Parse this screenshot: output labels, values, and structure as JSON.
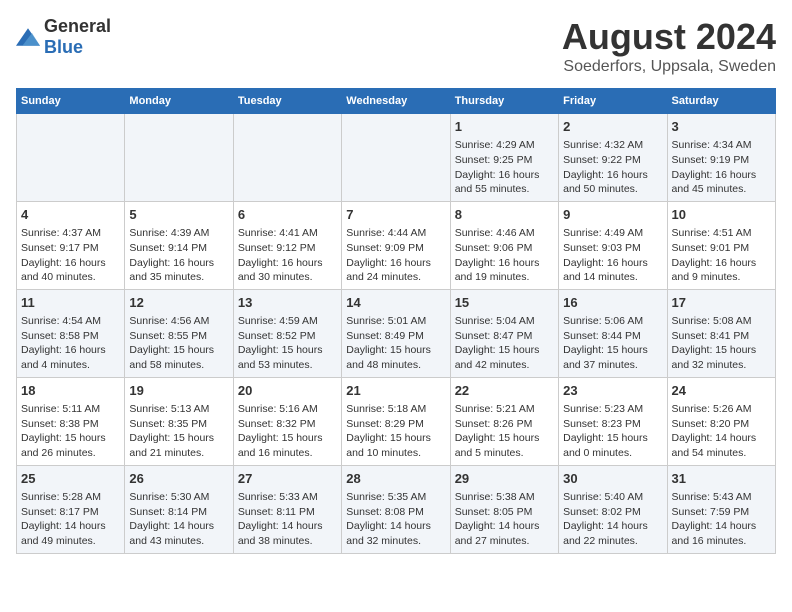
{
  "header": {
    "logo_general": "General",
    "logo_blue": "Blue",
    "title": "August 2024",
    "subtitle": "Soederfors, Uppsala, Sweden"
  },
  "columns": [
    "Sunday",
    "Monday",
    "Tuesday",
    "Wednesday",
    "Thursday",
    "Friday",
    "Saturday"
  ],
  "weeks": [
    [
      {
        "day": "",
        "lines": []
      },
      {
        "day": "",
        "lines": []
      },
      {
        "day": "",
        "lines": []
      },
      {
        "day": "",
        "lines": []
      },
      {
        "day": "1",
        "lines": [
          "Sunrise: 4:29 AM",
          "Sunset: 9:25 PM",
          "Daylight: 16 hours",
          "and 55 minutes."
        ]
      },
      {
        "day": "2",
        "lines": [
          "Sunrise: 4:32 AM",
          "Sunset: 9:22 PM",
          "Daylight: 16 hours",
          "and 50 minutes."
        ]
      },
      {
        "day": "3",
        "lines": [
          "Sunrise: 4:34 AM",
          "Sunset: 9:19 PM",
          "Daylight: 16 hours",
          "and 45 minutes."
        ]
      }
    ],
    [
      {
        "day": "4",
        "lines": [
          "Sunrise: 4:37 AM",
          "Sunset: 9:17 PM",
          "Daylight: 16 hours",
          "and 40 minutes."
        ]
      },
      {
        "day": "5",
        "lines": [
          "Sunrise: 4:39 AM",
          "Sunset: 9:14 PM",
          "Daylight: 16 hours",
          "and 35 minutes."
        ]
      },
      {
        "day": "6",
        "lines": [
          "Sunrise: 4:41 AM",
          "Sunset: 9:12 PM",
          "Daylight: 16 hours",
          "and 30 minutes."
        ]
      },
      {
        "day": "7",
        "lines": [
          "Sunrise: 4:44 AM",
          "Sunset: 9:09 PM",
          "Daylight: 16 hours",
          "and 24 minutes."
        ]
      },
      {
        "day": "8",
        "lines": [
          "Sunrise: 4:46 AM",
          "Sunset: 9:06 PM",
          "Daylight: 16 hours",
          "and 19 minutes."
        ]
      },
      {
        "day": "9",
        "lines": [
          "Sunrise: 4:49 AM",
          "Sunset: 9:03 PM",
          "Daylight: 16 hours",
          "and 14 minutes."
        ]
      },
      {
        "day": "10",
        "lines": [
          "Sunrise: 4:51 AM",
          "Sunset: 9:01 PM",
          "Daylight: 16 hours",
          "and 9 minutes."
        ]
      }
    ],
    [
      {
        "day": "11",
        "lines": [
          "Sunrise: 4:54 AM",
          "Sunset: 8:58 PM",
          "Daylight: 16 hours",
          "and 4 minutes."
        ]
      },
      {
        "day": "12",
        "lines": [
          "Sunrise: 4:56 AM",
          "Sunset: 8:55 PM",
          "Daylight: 15 hours",
          "and 58 minutes."
        ]
      },
      {
        "day": "13",
        "lines": [
          "Sunrise: 4:59 AM",
          "Sunset: 8:52 PM",
          "Daylight: 15 hours",
          "and 53 minutes."
        ]
      },
      {
        "day": "14",
        "lines": [
          "Sunrise: 5:01 AM",
          "Sunset: 8:49 PM",
          "Daylight: 15 hours",
          "and 48 minutes."
        ]
      },
      {
        "day": "15",
        "lines": [
          "Sunrise: 5:04 AM",
          "Sunset: 8:47 PM",
          "Daylight: 15 hours",
          "and 42 minutes."
        ]
      },
      {
        "day": "16",
        "lines": [
          "Sunrise: 5:06 AM",
          "Sunset: 8:44 PM",
          "Daylight: 15 hours",
          "and 37 minutes."
        ]
      },
      {
        "day": "17",
        "lines": [
          "Sunrise: 5:08 AM",
          "Sunset: 8:41 PM",
          "Daylight: 15 hours",
          "and 32 minutes."
        ]
      }
    ],
    [
      {
        "day": "18",
        "lines": [
          "Sunrise: 5:11 AM",
          "Sunset: 8:38 PM",
          "Daylight: 15 hours",
          "and 26 minutes."
        ]
      },
      {
        "day": "19",
        "lines": [
          "Sunrise: 5:13 AM",
          "Sunset: 8:35 PM",
          "Daylight: 15 hours",
          "and 21 minutes."
        ]
      },
      {
        "day": "20",
        "lines": [
          "Sunrise: 5:16 AM",
          "Sunset: 8:32 PM",
          "Daylight: 15 hours",
          "and 16 minutes."
        ]
      },
      {
        "day": "21",
        "lines": [
          "Sunrise: 5:18 AM",
          "Sunset: 8:29 PM",
          "Daylight: 15 hours",
          "and 10 minutes."
        ]
      },
      {
        "day": "22",
        "lines": [
          "Sunrise: 5:21 AM",
          "Sunset: 8:26 PM",
          "Daylight: 15 hours",
          "and 5 minutes."
        ]
      },
      {
        "day": "23",
        "lines": [
          "Sunrise: 5:23 AM",
          "Sunset: 8:23 PM",
          "Daylight: 15 hours",
          "and 0 minutes."
        ]
      },
      {
        "day": "24",
        "lines": [
          "Sunrise: 5:26 AM",
          "Sunset: 8:20 PM",
          "Daylight: 14 hours",
          "and 54 minutes."
        ]
      }
    ],
    [
      {
        "day": "25",
        "lines": [
          "Sunrise: 5:28 AM",
          "Sunset: 8:17 PM",
          "Daylight: 14 hours",
          "and 49 minutes."
        ]
      },
      {
        "day": "26",
        "lines": [
          "Sunrise: 5:30 AM",
          "Sunset: 8:14 PM",
          "Daylight: 14 hours",
          "and 43 minutes."
        ]
      },
      {
        "day": "27",
        "lines": [
          "Sunrise: 5:33 AM",
          "Sunset: 8:11 PM",
          "Daylight: 14 hours",
          "and 38 minutes."
        ]
      },
      {
        "day": "28",
        "lines": [
          "Sunrise: 5:35 AM",
          "Sunset: 8:08 PM",
          "Daylight: 14 hours",
          "and 32 minutes."
        ]
      },
      {
        "day": "29",
        "lines": [
          "Sunrise: 5:38 AM",
          "Sunset: 8:05 PM",
          "Daylight: 14 hours",
          "and 27 minutes."
        ]
      },
      {
        "day": "30",
        "lines": [
          "Sunrise: 5:40 AM",
          "Sunset: 8:02 PM",
          "Daylight: 14 hours",
          "and 22 minutes."
        ]
      },
      {
        "day": "31",
        "lines": [
          "Sunrise: 5:43 AM",
          "Sunset: 7:59 PM",
          "Daylight: 14 hours",
          "and 16 minutes."
        ]
      }
    ]
  ]
}
